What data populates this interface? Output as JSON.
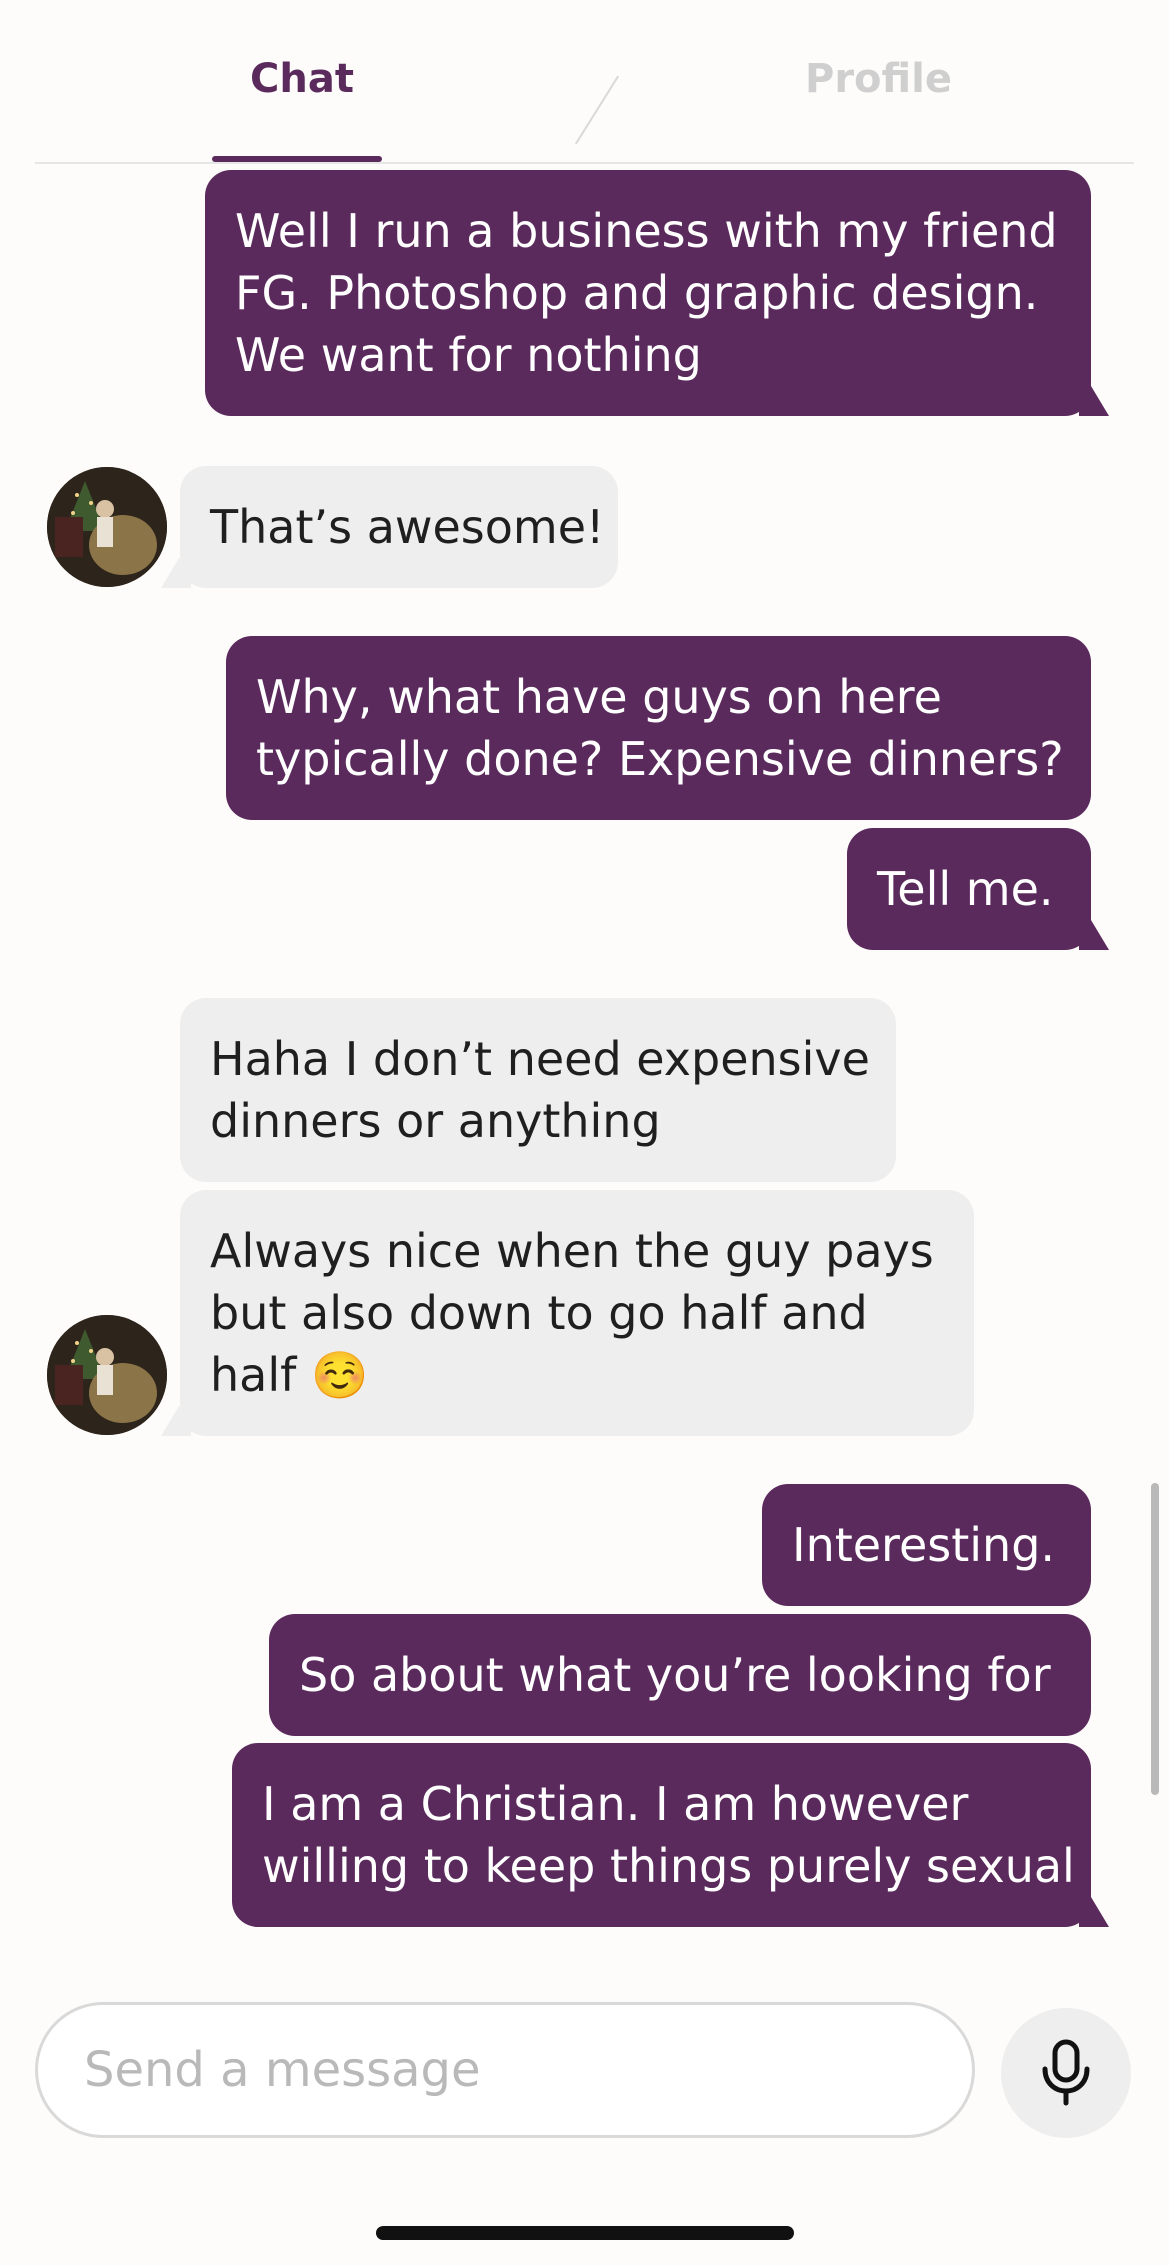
{
  "tabs": {
    "chat": "Chat",
    "profile": "Profile"
  },
  "messages": [
    {
      "direction": "sent",
      "lines": [
        "Well I run a business with my friend",
        "FG. Photoshop and graphic design.",
        "We want for nothing"
      ]
    },
    {
      "direction": "received",
      "lines": [
        "That’s awesome!"
      ]
    },
    {
      "direction": "sent",
      "lines": [
        "Why, what have guys on here",
        "typically done? Expensive dinners?"
      ]
    },
    {
      "direction": "sent",
      "lines": [
        "Tell me."
      ]
    },
    {
      "direction": "received",
      "lines": [
        "Haha I don’t need expensive",
        "dinners or anything"
      ]
    },
    {
      "direction": "received",
      "lines": [
        "Always nice when the guy pays",
        "but also down to go half and",
        "half ☺️"
      ]
    },
    {
      "direction": "sent",
      "lines": [
        "Interesting."
      ]
    },
    {
      "direction": "sent",
      "lines": [
        "So about what you’re looking for"
      ]
    },
    {
      "direction": "sent",
      "lines": [
        "I am a Christian. I am however",
        "willing to keep things purely sexual"
      ]
    }
  ],
  "composer": {
    "placeholder": "Send a message",
    "value": ""
  },
  "icons": {
    "mic": "microphone-icon",
    "avatar": "avatar"
  },
  "colors": {
    "accent": "#5b2a5c",
    "received_bubble": "#eeeeee",
    "tab_inactive": "#cfcfcf"
  }
}
